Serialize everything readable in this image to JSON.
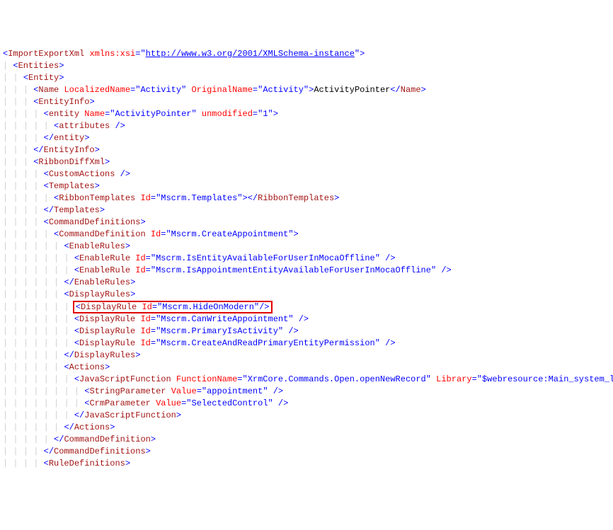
{
  "root": {
    "tag": "ImportExportXml",
    "attr": "xmlns:xsi",
    "url": "http://www.w3.org/2001/XMLSchema-instance"
  },
  "entities": "Entities",
  "entity": "Entity",
  "name": {
    "tag": "Name",
    "a1": "LocalizedName",
    "v1": "Activity",
    "a2": "OriginalName",
    "v2": "Activity",
    "text": "ActivityPointer"
  },
  "entityinfo": "EntityInfo",
  "entityEl": {
    "tag": "entity",
    "a1": "Name",
    "v1": "ActivityPointer",
    "a2": "unmodified",
    "v2": "1"
  },
  "attributes": "attributes",
  "ribbondiff": "RibbonDiffXml",
  "customactions": "CustomActions",
  "templates": "Templates",
  "ribbontemplates": {
    "tag": "RibbonTemplates",
    "attr": "Id",
    "val": "Mscrm.Templates"
  },
  "commanddefs": "CommandDefinitions",
  "commanddef": {
    "tag": "CommandDefinition",
    "attr": "Id",
    "val": "Mscrm.CreateAppointment"
  },
  "enablerules": "EnableRules",
  "er1": {
    "tag": "EnableRule",
    "attr": "Id",
    "val": "Mscrm.IsEntityAvailableForUserInMocaOffline"
  },
  "er2": {
    "tag": "EnableRule",
    "attr": "Id",
    "val": "Mscrm.IsAppointmentEntityAvailableForUserInMocaOffline"
  },
  "displayrules": "DisplayRules",
  "dr1": {
    "tag": "DisplayRule",
    "attr": "Id",
    "val": "Mscrm.HideOnModern"
  },
  "dr2": {
    "tag": "DisplayRule",
    "attr": "Id",
    "val": "Mscrm.CanWriteAppointment"
  },
  "dr3": {
    "tag": "DisplayRule",
    "attr": "Id",
    "val": "Mscrm.PrimaryIsActivity"
  },
  "dr4": {
    "tag": "DisplayRule",
    "attr": "Id",
    "val": "Mscrm.CreateAndReadPrimaryEntityPermission"
  },
  "actions": "Actions",
  "jsfunc": {
    "tag": "JavaScriptFunction",
    "a1": "FunctionName",
    "v1": "XrmCore.Commands.Open.openNewRecord",
    "a2": "Library",
    "v2": "$webresource:Main_system_library.js"
  },
  "sparam": {
    "tag": "StringParameter",
    "attr": "Value",
    "val": "appointment"
  },
  "cparam": {
    "tag": "CrmParameter",
    "attr": "Value",
    "val": "SelectedControl"
  },
  "ruledefs": "RuleDefinitions",
  "guides": {
    "g0": "",
    "g1": "│ ",
    "g2": "│ │ ",
    "g3": "│ │ │ ",
    "g4": "│ │ │ │ ",
    "g5": "│ │ │ │ │ ",
    "g6": "│ │ │ │ │ │ ",
    "g7": "│ │ │ │ │ │ │ ",
    "g8": "│ │ │ │ │ │ │ │ ",
    "g9": "│ │ │ │ │ │ │ │ │ "
  }
}
